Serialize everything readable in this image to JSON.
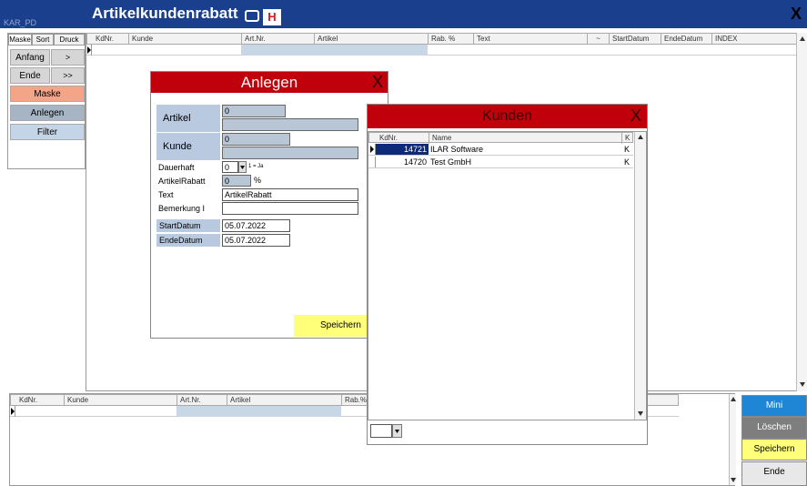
{
  "window": {
    "corner_label": "KAR_PD",
    "title": "Artikelkundenrabatt",
    "h_icon": "H",
    "close": "X"
  },
  "left_tabs": [
    "Maske",
    "Sort",
    "Druck"
  ],
  "left_buttons": {
    "anfang": "Anfang",
    "prev": ">",
    "ende": "Ende",
    "next": ">>",
    "maske": "Maske",
    "anlegen": "Anlegen",
    "filter": "Filter"
  },
  "top_grid": {
    "columns": [
      "KdNr.",
      "Kunde",
      "Art.Nr.",
      "Artikel",
      "Rab. %",
      "Text",
      "~",
      "StartDatum",
      "EndeDatum",
      "INDEX"
    ]
  },
  "bottom_grid": {
    "columns": [
      "KdNr.",
      "Kunde",
      "Art.Nr.",
      "Artikel",
      "Rab.%"
    ]
  },
  "anlegen_dialog": {
    "title": "Anlegen",
    "close": "X",
    "artikel_label": "Artikel",
    "artikel_value": "0",
    "kunde_label": "Kunde",
    "kunde_value": "0",
    "dauerhaft_label": "Dauerhaft",
    "dauerhaft_value": "0",
    "dauerhaft_hint": "1 = Ja",
    "artikelrabatt_label": "ArtikelRabatt",
    "artikelrabatt_value": "0",
    "percent": "%",
    "text_label": "Text",
    "text_value": "ArtikelRabatt",
    "bemerkung_label": "Bemerkung I",
    "bemerkung_value": "",
    "start_label": "StartDatum",
    "start_value": "05.07.2022",
    "ende_label": "EndeDatum",
    "ende_value": "05.07.2022",
    "save": "Speichern"
  },
  "kunden_dialog": {
    "title": "Kunden",
    "close": "X",
    "columns": [
      "KdNr.",
      "Name",
      "K"
    ],
    "rows": [
      {
        "kdnr": "14721",
        "name": "ILAR Software",
        "k": "K"
      },
      {
        "kdnr": "14720",
        "name": "Test GmbH",
        "k": "K"
      }
    ]
  },
  "right_buttons": {
    "mini": "Mini",
    "loeschen": "Löschen",
    "speichern": "Speichern",
    "ende": "Ende"
  },
  "colors": {
    "titlebar": "#1a3f8c",
    "dialog_header": "#c0000a",
    "maske_button": "#f4a587",
    "label_blue": "#b8c9e0",
    "save_yellow": "#ffff7a",
    "mini_blue": "#1f86d6"
  }
}
